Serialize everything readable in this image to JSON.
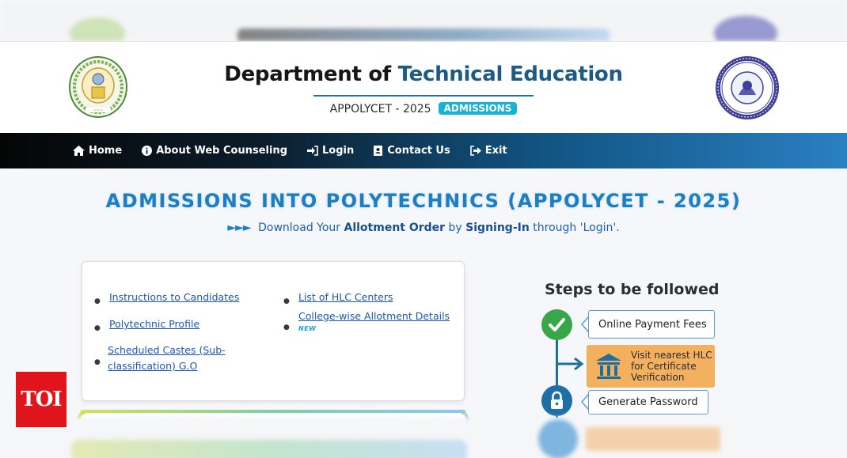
{
  "header": {
    "title_part1": "Department of",
    "title_part2": "Technical Education",
    "subtitle": "APPOLYCET - 2025",
    "badge": "ADMISSIONS"
  },
  "nav": {
    "items": [
      {
        "label": "Home",
        "icon": "home-icon"
      },
      {
        "label": "About Web Counseling",
        "icon": "info-icon"
      },
      {
        "label": "Login",
        "icon": "login-icon"
      },
      {
        "label": "Contact Us",
        "icon": "contact-icon"
      },
      {
        "label": "Exit",
        "icon": "exit-icon"
      }
    ]
  },
  "main": {
    "heading": "ADMISSIONS INTO POLYTECHNICS (APPOLYCET - 2025)",
    "marquee_arrows": "►►►",
    "marquee_part1": "Download Your",
    "marquee_bold": "Allotment Order",
    "marquee_part2": "by",
    "marquee_bold2": "Signing-In",
    "marquee_part3": "through 'Login'."
  },
  "links": {
    "left": [
      "Instructions to Candidates",
      "Polytechnic Profile",
      "Scheduled Castes (Sub-classification) G.O"
    ],
    "right": [
      "List of HLC Centers",
      "College-wise Allotment Details"
    ],
    "new_label": "NEW"
  },
  "steps": {
    "title": "Steps to be followed",
    "step1": "Online Payment Fees",
    "step2_line1": "Visit nearest HLC",
    "step2_line2": "for Certificate",
    "step2_line3": "Verification",
    "step3": "Generate Password"
  },
  "watermark": "TOI",
  "colors": {
    "accent": "#1d7ec4",
    "badge": "#14b4d8",
    "step_orange": "#f3b160",
    "check_green": "#3aa64a",
    "toi_red": "#e0141b"
  }
}
